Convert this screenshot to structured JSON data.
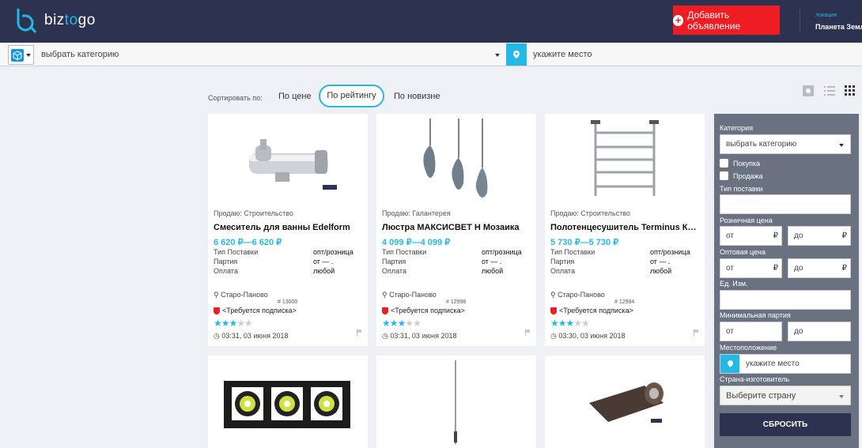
{
  "header": {
    "brand_a": "biz",
    "brand_b": "to",
    "brand_c": "go",
    "add_button": "Добавить объявление",
    "location_label": "локация",
    "location_value": "Планета Земля"
  },
  "search": {
    "category_placeholder": "выбрать категорию",
    "place_placeholder": "укажите место"
  },
  "sort": {
    "label": "Сортировать по:",
    "options": [
      "По цене",
      "По рейтингу",
      "По новизне"
    ],
    "active": "По рейтингу"
  },
  "cards": [
    {
      "category": "Продаю: Строительство",
      "title": "Смеситель для ванны Edelform",
      "price": "6 620 ₽—6 620 ₽",
      "rows": [
        {
          "k": "Тип Поставки",
          "v": "опт/розница"
        },
        {
          "k": "Партия",
          "v": "от — ."
        },
        {
          "k": "Оплата",
          "v": "любой"
        }
      ],
      "city": "Старо-Паново",
      "num": "# 13000",
      "sub": "<Требуется подписка>",
      "rating": 3,
      "date": "03:31, 03 июня 2018"
    },
    {
      "category": "Продаю: Галантерея",
      "title": "Люстра МАКСИСВЕТ Н Мозаика",
      "price": "4 099 ₽—4 099 ₽",
      "rows": [
        {
          "k": "Тип Поставки",
          "v": "опт/розница"
        },
        {
          "k": "Партия",
          "v": "от — ."
        },
        {
          "k": "Оплата",
          "v": "любой"
        }
      ],
      "city": "Старо-Паново",
      "num": "# 12996",
      "sub": "<Требуется подписка>",
      "rating": 3,
      "date": "03:31, 03 июня 2018"
    },
    {
      "category": "Продаю: Строительство",
      "title": "Полотенцесушитель Terminus Классик",
      "price": "5 730 ₽—5 730 ₽",
      "rows": [
        {
          "k": "Тип Поставки",
          "v": "опт/розница"
        },
        {
          "k": "Партия",
          "v": "от — ."
        },
        {
          "k": "Оплата",
          "v": "любой"
        }
      ],
      "city": "Старо-Паново",
      "num": "# 12994",
      "sub": "<Требуется подписка>",
      "rating": 3,
      "date": "03:30, 03 июня 2018"
    }
  ],
  "sidebar": {
    "category_label": "Категория",
    "category_value": "выбрать категорию",
    "buy": "Покупка",
    "sell": "Продажа",
    "supply_label": "Тип поставки",
    "retail_label": "Розничная цена",
    "wholesale_label": "Оптовая цена",
    "from": "от",
    "to": "до",
    "rub": "₽",
    "unit_label": "Ед. Изм.",
    "min_label": "Минимальная партия",
    "place_label": "Местоположение",
    "place_value": "укажите место",
    "country_label": "Страна-изготовитель",
    "country_value": "Выберите страну",
    "reset": "СБРОСИТЬ"
  }
}
